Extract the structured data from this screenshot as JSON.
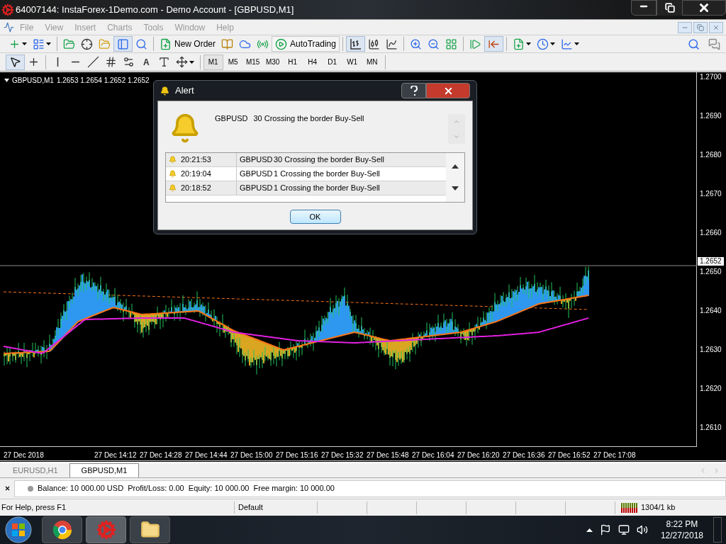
{
  "window": {
    "title": "64007144: InstaForex-1Demo.com - Demo Account - [GBPUSD,M1]"
  },
  "menu": [
    "File",
    "View",
    "Insert",
    "Charts",
    "Tools",
    "Window",
    "Help"
  ],
  "toolbar": {
    "new_order": "New Order",
    "auto_trading": "AutoTrading"
  },
  "drawing_tools": {
    "text_tool": "A"
  },
  "timeframes": [
    {
      "label": "M1",
      "selected": true
    },
    {
      "label": "M5",
      "selected": false
    },
    {
      "label": "M15",
      "selected": false
    },
    {
      "label": "M30",
      "selected": false
    },
    {
      "label": "H1",
      "selected": false
    },
    {
      "label": "H4",
      "selected": false
    },
    {
      "label": "D1",
      "selected": false
    },
    {
      "label": "W1",
      "selected": false
    },
    {
      "label": "MN",
      "selected": false
    }
  ],
  "chart": {
    "symbol": "GBPUSD,M1",
    "quotes": "1.2653 1.2654 1.2652 1.2652",
    "current_price": "1.2652",
    "price_labels": [
      "1.2700",
      "1.2690",
      "1.2680",
      "1.2670",
      "1.2660",
      "1.2650",
      "1.2640",
      "1.2630",
      "1.2620",
      "1.2610"
    ],
    "time_labels": [
      "27 Dec 2018",
      "27 Dec 14:12",
      "27 Dec 14:28",
      "27 Dec 14:44",
      "27 Dec 15:00",
      "27 Dec 15:16",
      "27 Dec 15:32",
      "27 Dec 15:48",
      "27 Dec 16:04",
      "27 Dec 16:20",
      "27 Dec 16:36",
      "27 Dec 16:52",
      "27 Dec 17:08"
    ]
  },
  "alert": {
    "title": "Alert",
    "symbol": "GBPUSD",
    "message": "30 Crossing the border Buy-Sell",
    "rows": [
      {
        "time": "20:21:53",
        "symbol": "GBPUSD",
        "message": "30 Crossing the border Buy-Sell"
      },
      {
        "time": "20:19:04",
        "symbol": "GBPUSD",
        "message": "1 Crossing the border Buy-Sell"
      },
      {
        "time": "20:18:52",
        "symbol": "GBPUSD",
        "message": "1 Crossing the border Buy-Sell"
      }
    ],
    "ok": "OK"
  },
  "chart_tabs": [
    {
      "label": "EURUSD,H1",
      "selected": false
    },
    {
      "label": "GBPUSD,M1",
      "selected": true
    }
  ],
  "account": {
    "summary": "Balance: 10 000.00 USD  Profit/Loss: 0.00  Equity: 10 000.00  Free margin: 10 000.00"
  },
  "status_bar": {
    "help": "For Help, press F1",
    "profile": "Default",
    "traffic": "1304/1 kb"
  },
  "taskbar": {
    "time": "8:22 PM",
    "date": "12/27/2018"
  }
}
